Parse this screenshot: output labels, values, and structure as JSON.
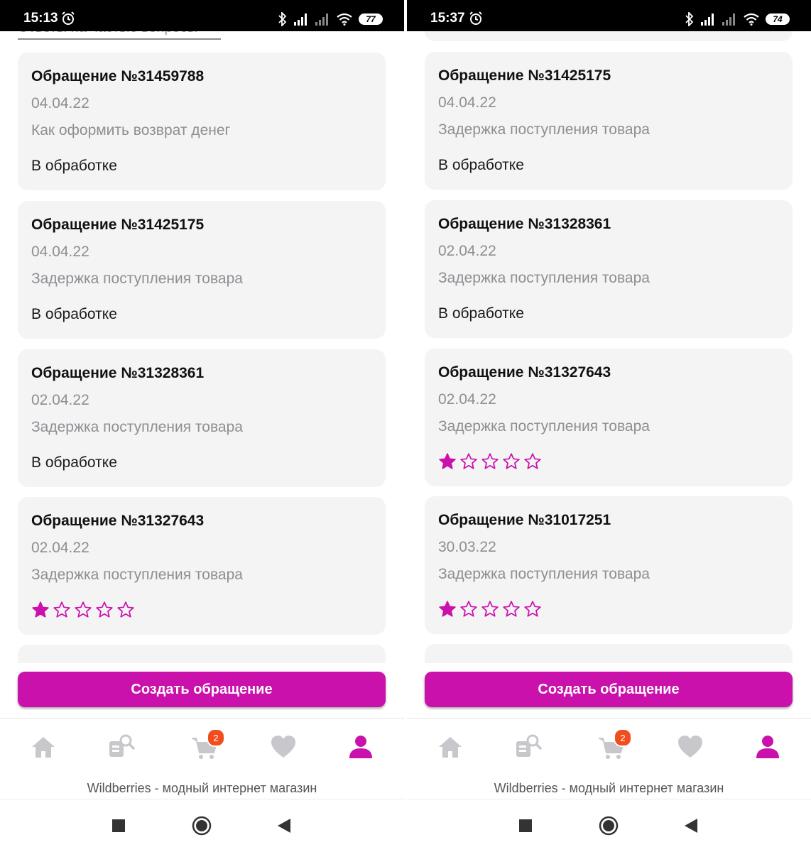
{
  "accent_color": "#cb11ab",
  "screens": [
    {
      "status": {
        "time": "15:13",
        "battery": "77"
      },
      "peek_link": "Ответы на частые вопросы",
      "tickets": [
        {
          "title": "Обращение №31459788",
          "date": "04.04.22",
          "topic": "Как оформить возврат денег",
          "status": "В обработке",
          "rating": null
        },
        {
          "title": "Обращение №31425175",
          "date": "04.04.22",
          "topic": "Задержка поступления товара",
          "status": "В обработке",
          "rating": null
        },
        {
          "title": "Обращение №31328361",
          "date": "02.04.22",
          "topic": "Задержка поступления товара",
          "status": "В обработке",
          "rating": null
        },
        {
          "title": "Обращение №31327643",
          "date": "02.04.22",
          "topic": "Задержка поступления товара",
          "status": null,
          "rating": 1
        }
      ],
      "create_button": "Создать обращение",
      "tabbar": {
        "cart_badge": "2",
        "caption": "Wildberries - модный интернет магазин"
      }
    },
    {
      "status": {
        "time": "15:37",
        "battery": "74"
      },
      "tickets": [
        {
          "title": "Обращение №31425175",
          "date": "04.04.22",
          "topic": "Задержка поступления товара",
          "status": "В обработке",
          "rating": null
        },
        {
          "title": "Обращение №31328361",
          "date": "02.04.22",
          "topic": "Задержка поступления товара",
          "status": "В обработке",
          "rating": null
        },
        {
          "title": "Обращение №31327643",
          "date": "02.04.22",
          "topic": "Задержка поступления товара",
          "status": null,
          "rating": 1
        },
        {
          "title": "Обращение №31017251",
          "date": "30.03.22",
          "topic": "Задержка поступления товара",
          "status": null,
          "rating": 1
        }
      ],
      "create_button": "Создать обращение",
      "tabbar": {
        "cart_badge": "2",
        "caption": "Wildberries - модный интернет магазин"
      }
    }
  ],
  "icons": [
    "alarm-icon",
    "bluetooth-icon",
    "signal-icon",
    "wifi-icon",
    "battery-icon",
    "star-icon",
    "home-icon",
    "catalog-search-icon",
    "cart-icon",
    "heart-icon",
    "profile-icon",
    "recents-icon",
    "home-circle-icon",
    "back-icon"
  ]
}
